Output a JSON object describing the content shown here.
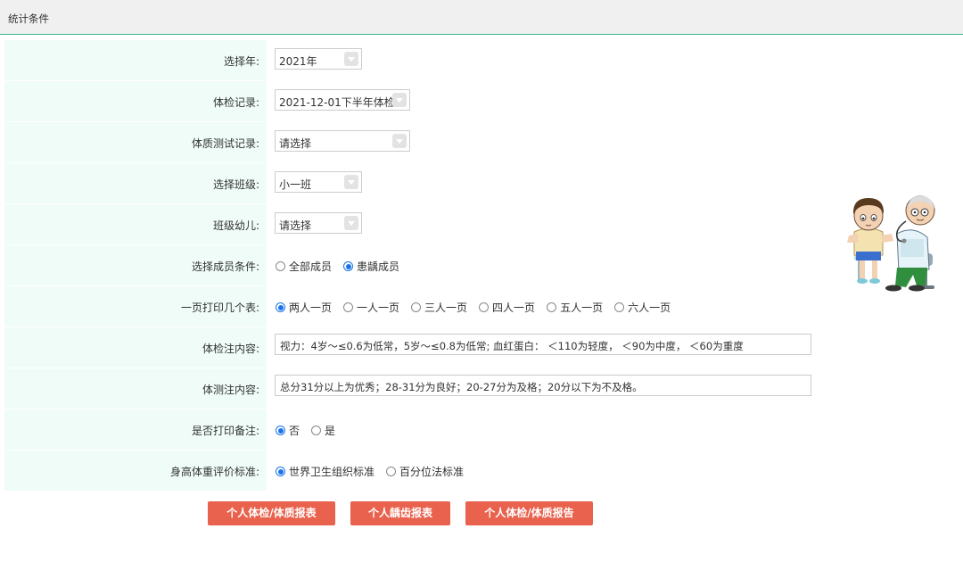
{
  "header": {
    "title": "统计条件"
  },
  "form": {
    "year": {
      "label": "选择年:",
      "value": "2021年"
    },
    "exam_record": {
      "label": "体检记录:",
      "value": "2021-12-01下半年体检"
    },
    "fitness_record": {
      "label": "体质测试记录:",
      "value": "请选择"
    },
    "class": {
      "label": "选择班级:",
      "value": "小一班"
    },
    "child": {
      "label": "班级幼儿:",
      "value": "请选择"
    },
    "member_condition": {
      "label": "选择成员条件:",
      "options": [
        "全部成员",
        "患龋成员"
      ],
      "selected": 1
    },
    "per_page": {
      "label": "一页打印几个表:",
      "options": [
        "两人一页",
        "一人一页",
        "三人一页",
        "四人一页",
        "五人一页",
        "六人一页"
      ],
      "selected": 0
    },
    "exam_note": {
      "label": "体检注内容:",
      "value": "视力：4岁～≤0.6为低常，5岁～≤0.8为低常; 血红蛋白： ＜110为轻度， ＜90为中度， ＜60为重度"
    },
    "fitness_note": {
      "label": "体测注内容:",
      "value": "总分31分以上为优秀；28-31分为良好；20-27分为及格；20分以下为不及格。"
    },
    "print_note": {
      "label": "是否打印备注:",
      "options": [
        "否",
        "是"
      ],
      "selected": 0
    },
    "standard": {
      "label": "身高体重评价标准:",
      "options": [
        "世界卫生组织标准",
        "百分位法标准"
      ],
      "selected": 0
    }
  },
  "buttons": {
    "personal_report": "个人体检/体质报表",
    "caries_report": "个人龋齿报表",
    "personal_summary": "个人体检/体质报告"
  },
  "illustration": {
    "icon": "doctor-child-illustration"
  },
  "colors": {
    "accent": "#3cb48c",
    "label_bg": "#effcf7",
    "button": "#e8624d",
    "radio": "#1a73e8"
  }
}
